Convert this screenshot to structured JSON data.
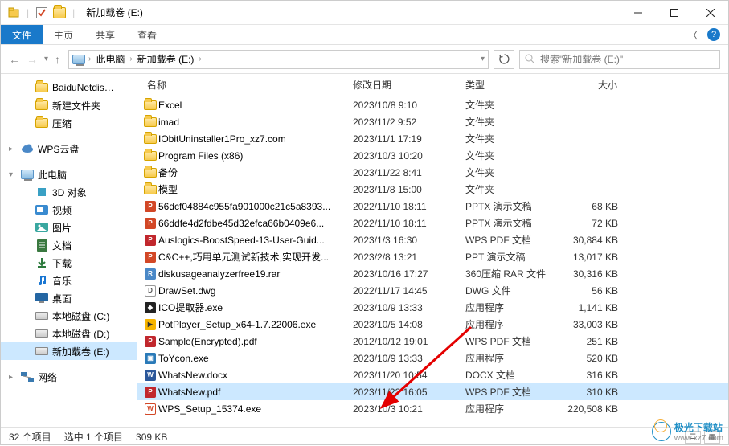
{
  "window": {
    "title": "新加载卷 (E:)",
    "qat_sep": "|",
    "checkbox_checked": true
  },
  "ribbon": {
    "file": "文件",
    "home": "主页",
    "share": "共享",
    "view": "查看"
  },
  "nav": {
    "crumb1": "此电脑",
    "crumb2": "新加载卷 (E:)",
    "search_placeholder": "搜索\"新加载卷 (E:)\""
  },
  "tree": {
    "items": [
      {
        "label": "BaiduNetdis…",
        "icon": "folder",
        "indent": 1
      },
      {
        "label": "新建文件夹",
        "icon": "folder",
        "indent": 1
      },
      {
        "label": "压缩",
        "icon": "folder",
        "indent": 1
      },
      {
        "spacer": true
      },
      {
        "label": "WPS云盘",
        "icon": "cloud",
        "indent": 0,
        "exp": "▸"
      },
      {
        "spacer": true
      },
      {
        "label": "此电脑",
        "icon": "pc",
        "indent": 0,
        "exp": "▾"
      },
      {
        "label": "3D 对象",
        "icon": "3d",
        "indent": 1
      },
      {
        "label": "视频",
        "icon": "video",
        "indent": 1
      },
      {
        "label": "图片",
        "icon": "pics",
        "indent": 1
      },
      {
        "label": "文档",
        "icon": "docs",
        "indent": 1
      },
      {
        "label": "下载",
        "icon": "dl",
        "indent": 1
      },
      {
        "label": "音乐",
        "icon": "music",
        "indent": 1
      },
      {
        "label": "桌面",
        "icon": "desk",
        "indent": 1
      },
      {
        "label": "本地磁盘 (C:)",
        "icon": "disk",
        "indent": 1
      },
      {
        "label": "本地磁盘 (D:)",
        "icon": "disk",
        "indent": 1
      },
      {
        "label": "新加载卷 (E:)",
        "icon": "disk",
        "indent": 1,
        "selected": true
      },
      {
        "spacer": true
      },
      {
        "label": "网络",
        "icon": "net",
        "indent": 0,
        "exp": "▸"
      }
    ]
  },
  "columns": {
    "name": "名称",
    "date": "修改日期",
    "type": "类型",
    "size": "大小"
  },
  "files": [
    {
      "name": "Excel",
      "date": "2023/10/8 9:10",
      "type": "文件夹",
      "size": "",
      "icon": "folder"
    },
    {
      "name": "imad",
      "date": "2023/11/2 9:52",
      "type": "文件夹",
      "size": "",
      "icon": "folder"
    },
    {
      "name": "IObitUninstaller1Pro_xz7.com",
      "date": "2023/11/1 17:19",
      "type": "文件夹",
      "size": "",
      "icon": "folder"
    },
    {
      "name": "Program Files (x86)",
      "date": "2023/10/3 10:20",
      "type": "文件夹",
      "size": "",
      "icon": "folder"
    },
    {
      "name": "备份",
      "date": "2023/11/22 8:41",
      "type": "文件夹",
      "size": "",
      "icon": "folder"
    },
    {
      "name": "模型",
      "date": "2023/11/8 15:00",
      "type": "文件夹",
      "size": "",
      "icon": "folder"
    },
    {
      "name": "56dcf04884c955fa901000c21c5a8393...",
      "date": "2022/11/10 18:11",
      "type": "PPTX 演示文稿",
      "size": "68 KB",
      "icon": "ppt"
    },
    {
      "name": "66ddfe4d2fdbe45d32efca66b0409e6...",
      "date": "2022/11/10 18:11",
      "type": "PPTX 演示文稿",
      "size": "72 KB",
      "icon": "ppt"
    },
    {
      "name": "Auslogics-BoostSpeed-13-User-Guid...",
      "date": "2023/1/3 16:30",
      "type": "WPS PDF 文档",
      "size": "30,884 KB",
      "icon": "pdf"
    },
    {
      "name": "C&C++,巧用单元测试新技术,实现开发...",
      "date": "2023/2/8 13:21",
      "type": "PPT 演示文稿",
      "size": "13,017 KB",
      "icon": "ppt"
    },
    {
      "name": "diskusageanalyzerfree19.rar",
      "date": "2023/10/16 17:27",
      "type": "360压缩 RAR 文件",
      "size": "30,316 KB",
      "icon": "rar"
    },
    {
      "name": "DrawSet.dwg",
      "date": "2022/11/17 14:45",
      "type": "DWG 文件",
      "size": "56 KB",
      "icon": "dwg"
    },
    {
      "name": "ICO提取器.exe",
      "date": "2023/10/9 13:33",
      "type": "应用程序",
      "size": "1,141 KB",
      "icon": "exe-dark"
    },
    {
      "name": "PotPlayer_Setup_x64-1.7.22006.exe",
      "date": "2023/10/5 14:08",
      "type": "应用程序",
      "size": "33,003 KB",
      "icon": "exe-pot"
    },
    {
      "name": "Sample(Encrypted).pdf",
      "date": "2012/10/12 19:01",
      "type": "WPS PDF 文档",
      "size": "251 KB",
      "icon": "pdf"
    },
    {
      "name": "ToYcon.exe",
      "date": "2023/10/9 13:33",
      "type": "应用程序",
      "size": "520 KB",
      "icon": "exe-blue"
    },
    {
      "name": "WhatsNew.docx",
      "date": "2023/11/20 10:54",
      "type": "DOCX 文档",
      "size": "316 KB",
      "icon": "docx"
    },
    {
      "name": "WhatsNew.pdf",
      "date": "2023/11/22 16:05",
      "type": "WPS PDF 文档",
      "size": "310 KB",
      "icon": "pdf",
      "selected": true
    },
    {
      "name": "WPS_Setup_15374.exe",
      "date": "2023/10/3 10:21",
      "type": "应用程序",
      "size": "220,508 KB",
      "icon": "exe-wps"
    }
  ],
  "status": {
    "count": "32 个项目",
    "selection": "选中 1 个项目",
    "size": "309 KB"
  },
  "watermark": {
    "text": "极光下载站",
    "url": "www.xz7.com"
  },
  "icon_colors": {
    "ppt": "#d24726",
    "pdf": "#c1272d",
    "rar": "#4a88c7",
    "dwg": "#7a7a7a",
    "exe-dark": "#222",
    "exe-pot": "#f7b500",
    "exe-blue": "#2a7ab8",
    "docx": "#2b579a",
    "exe-wps": "#fff",
    "cloud": "#4a88c7",
    "3d": "#39a0c4",
    "video": "#3a8bd0",
    "pics": "#39a7a0",
    "docs": "#3a7940",
    "dl": "#2c7a3d",
    "music": "#1976d2",
    "desk": "#2466a3",
    "net": "#3a7ab0"
  }
}
